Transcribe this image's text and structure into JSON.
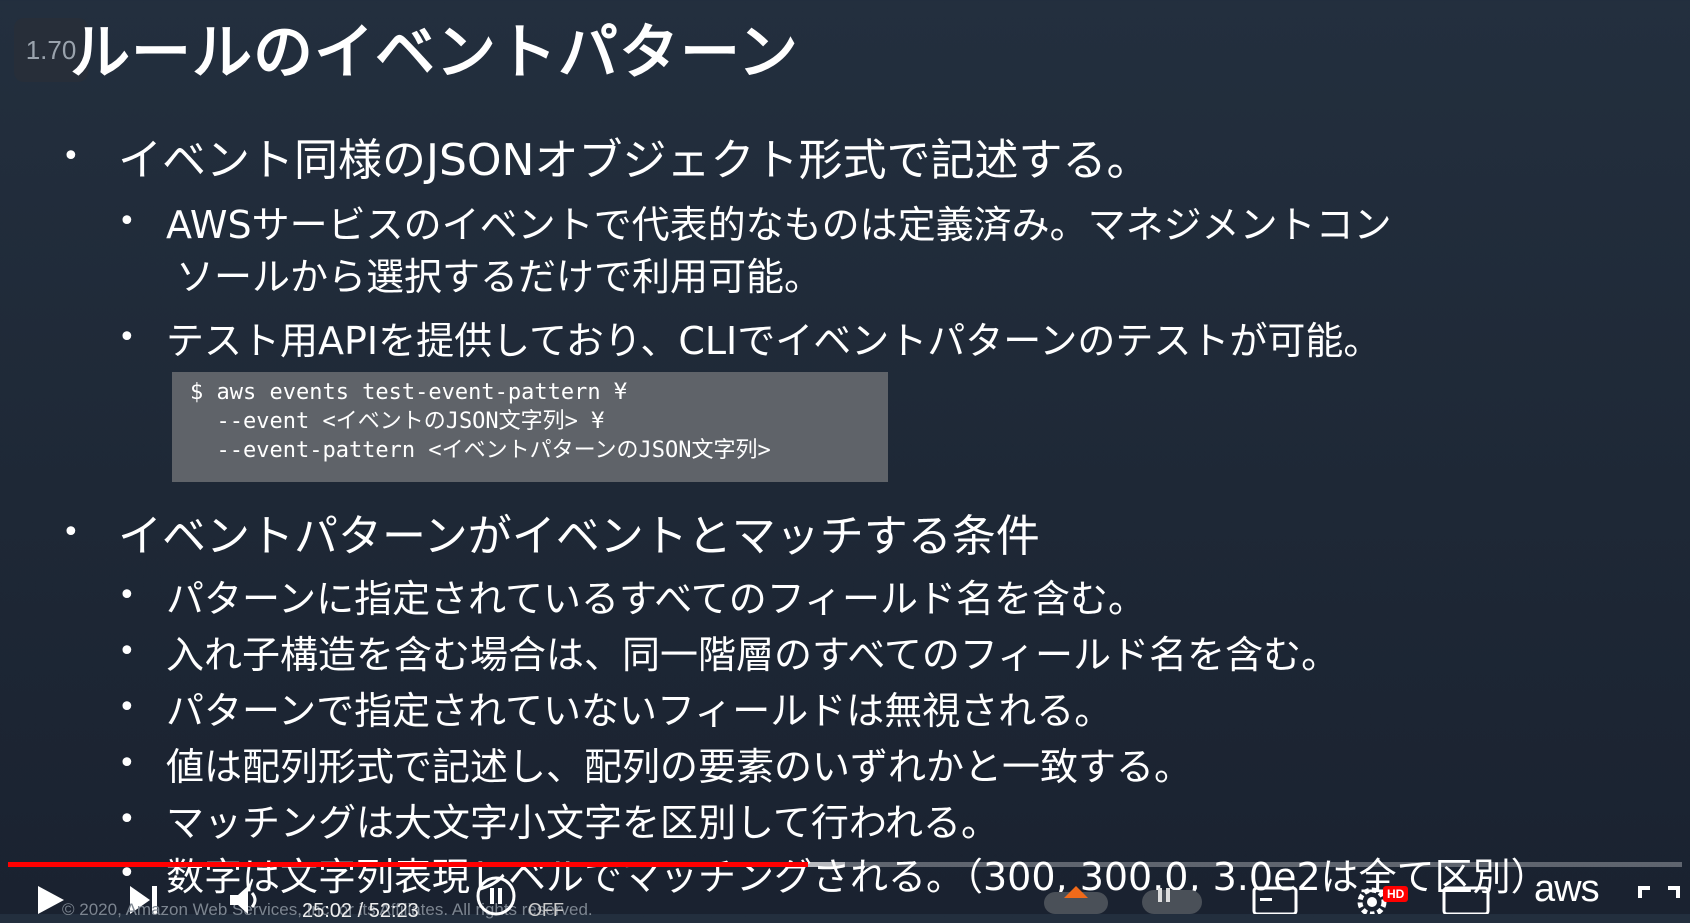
{
  "player": {
    "speed": "1.70",
    "time_text": "25:02 / 52:23",
    "copyright": "© 2020, Amazon Web Services, Inc. or its Affiliates. All rights reserved.",
    "autoplay_state": "OFF",
    "quality_badge": "HD",
    "progress": 0.478,
    "buffer": 0.5
  },
  "slide": {
    "title": "ルールのイベントパターン",
    "sections": [
      {
        "text": "イベント同様のJSONオブジェクト形式で記述する。",
        "items": [
          "AWSサービスのイベントで代表的なものは定義済み。マネジメントコン",
          "ソールから選択するだけで利用可能。",
          "テスト用APIを提供しており、CLIでイベントパターンのテストが可能。"
        ]
      },
      {
        "text": "イベントパターンがイベントとマッチする条件",
        "items": [
          "パターンに指定されているすべてのフィールド名を含む。",
          "入れ子構造を含む場合は、同一階層のすべてのフィールド名を含む。",
          "パターンで指定されていないフィールドは無視される。",
          "値は配列形式で記述し、配列の要素のいずれかと一致する。",
          "マッチングは大文字小文字を区別して行われる。",
          "数字は文字列表現レベルでマッチングされる。（300, 300.0, 3.0e2は全て区別）"
        ]
      }
    ],
    "code_lines": [
      "$ aws events test-event-pattern ¥",
      "  --event <イベントのJSON文字列> ¥",
      "  --event-pattern <イベントパターンのJSON文字列>"
    ],
    "aws_logo_text": "aws"
  }
}
